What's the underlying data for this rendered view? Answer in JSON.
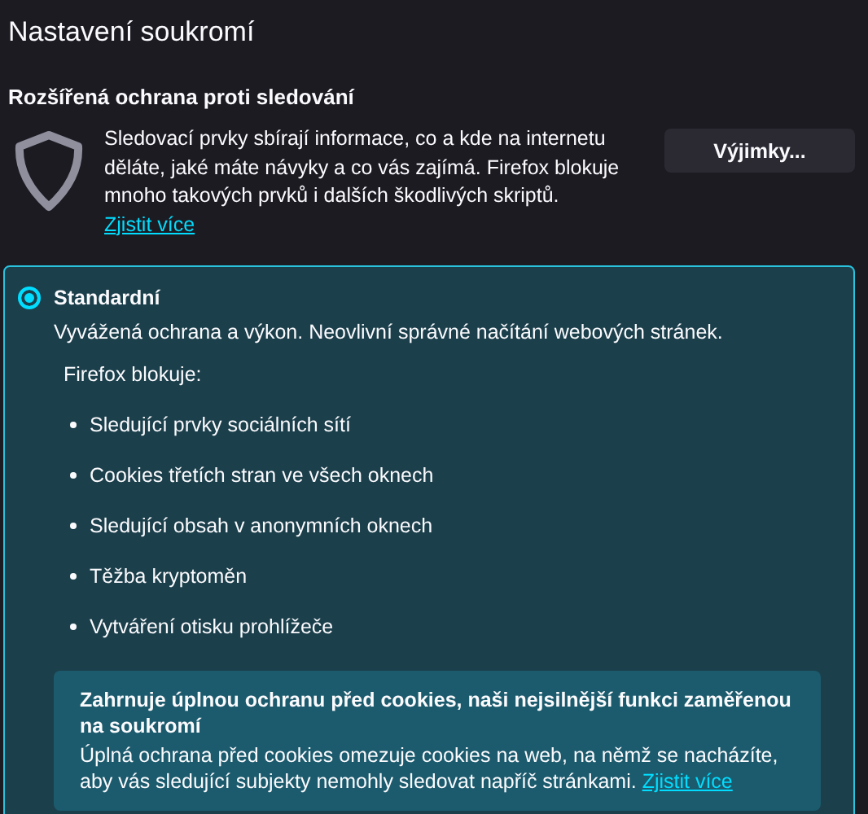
{
  "title": "Nastavení soukromí",
  "section": {
    "heading": "Rozšířená ochrana proti sledování",
    "description": "Sledovací prvky sbírají informace, co a kde na internetu děláte, jaké máte návyky a co vás zajímá. Firefox blokuje mnoho takových prvků i dalších škodlivých skriptů.",
    "link": "Zjistit více",
    "button": "Výjimky..."
  },
  "options": [
    {
      "label": "Standardní",
      "selected": true,
      "description": "Vyvážená ochrana a výkon. Neovlivní správné načítání webových stránek.",
      "blocks_heading": "Firefox blokuje:",
      "blocks": [
        "Sledující prvky sociálních sítí",
        "Cookies třetích stran ve všech oknech",
        "Sledující obsah v anonymních oknech",
        "Těžba kryptoměn",
        "Vytváření otisku prohlížeče"
      ],
      "info": {
        "title": "Zahrnuje úplnou ochranu před cookies, naši nejsilnější funkci zaměřenou na soukromí",
        "text": "Úplná ochrana před cookies omezuje cookies na web, na němž se nacházíte, aby vás sledující subjekty nemohly sledovat napříč stránkami.",
        "link": "Zjistit více"
      }
    }
  ]
}
